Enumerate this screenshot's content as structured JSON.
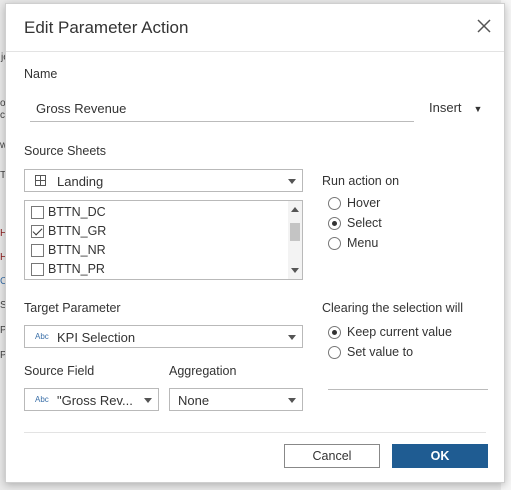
{
  "dialog": {
    "title": "Edit Parameter Action"
  },
  "name_section": {
    "label": "Name",
    "value": "Gross Revenue",
    "insert_label": "Insert"
  },
  "source_sheets": {
    "label": "Source Sheets",
    "selected": "Landing",
    "items": [
      {
        "label": "BTTN_DC",
        "checked": false
      },
      {
        "label": "BTTN_GR",
        "checked": true
      },
      {
        "label": "BTTN_NR",
        "checked": false
      },
      {
        "label": "BTTN_PR",
        "checked": false
      }
    ]
  },
  "run_action": {
    "label": "Run action on",
    "options": [
      {
        "label": "Hover",
        "selected": false
      },
      {
        "label": "Select",
        "selected": true
      },
      {
        "label": "Menu",
        "selected": false
      }
    ]
  },
  "target_parameter": {
    "label": "Target Parameter",
    "type_badge": "Abc",
    "value": "KPI Selection"
  },
  "clearing": {
    "label": "Clearing the selection will",
    "options": [
      {
        "label": "Keep current value",
        "selected": true
      },
      {
        "label": "Set value to",
        "selected": false
      }
    ]
  },
  "source_field": {
    "label": "Source Field",
    "type_badge": "Abc",
    "value": "\"Gross Rev..."
  },
  "aggregation": {
    "label": "Aggregation",
    "value": "None"
  },
  "buttons": {
    "cancel": "Cancel",
    "ok": "OK"
  },
  "background": {
    "left_fragments": [
      "je",
      "o",
      "c",
      "w",
      "T",
      "H",
      "H",
      "C",
      "S",
      "P",
      "P"
    ]
  },
  "colors": {
    "ok_button": "#1f5c92",
    "type_badge": "#3a6fa8"
  }
}
